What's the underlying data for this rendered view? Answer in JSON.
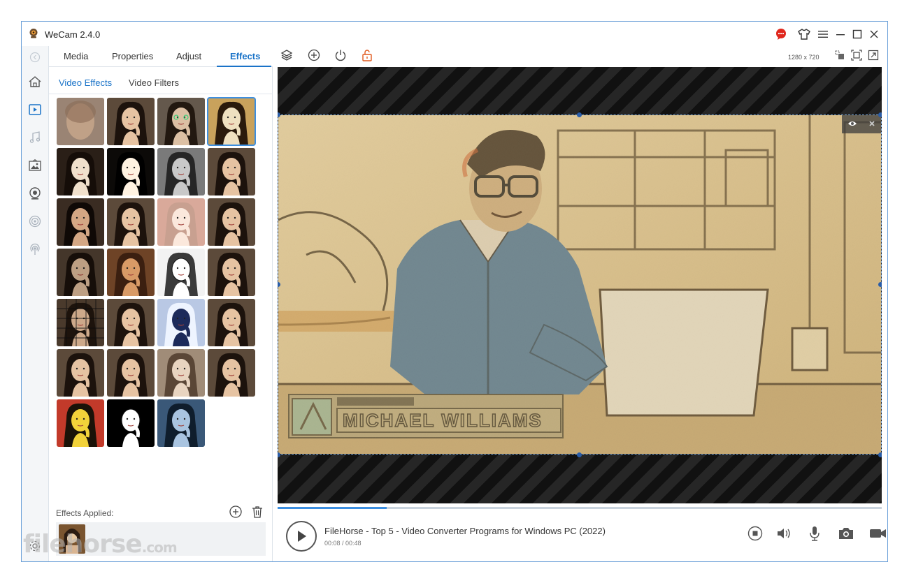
{
  "window": {
    "title": "WeCam 2.4.0",
    "resolution": "1280 x 720"
  },
  "tabs": [
    {
      "label": "Media"
    },
    {
      "label": "Properties"
    },
    {
      "label": "Adjust"
    },
    {
      "label": "Effects",
      "active": true
    }
  ],
  "effects_panel": {
    "subtabs": [
      {
        "label": "Video Effects",
        "active": true
      },
      {
        "label": "Video Filters"
      }
    ],
    "thumbnails": [
      "blur",
      "normal",
      "face-detect",
      "sketch-selected",
      "dark-vignette",
      "high-contrast",
      "grayscale",
      "normal",
      "dark",
      "normal",
      "light-leak",
      "normal",
      "noise",
      "sepia",
      "pencil-bw",
      "normal",
      "grid",
      "normal",
      "negative",
      "normal",
      "normal",
      "normal",
      "faded",
      "normal",
      "pop-art",
      "silhouette",
      "cool-tone"
    ],
    "applied_label": "Effects Applied:"
  },
  "video": {
    "caption": "MICHAEL WILLIAMS"
  },
  "player": {
    "title": "FileHorse - Top 5 - Video Converter Programs for Windows PC (2022)",
    "time": "00:08 / 00:48",
    "progress": 0.18
  },
  "watermark": {
    "text": "filehorse",
    "suffix": ".com"
  },
  "colors": {
    "accent": "#1a73c8",
    "selection": "#3d8fe0"
  },
  "icons": {
    "titlebar": [
      "chat-icon",
      "skin-icon",
      "menu-icon",
      "minimize-icon",
      "maximize-icon",
      "close-icon"
    ],
    "toolbar": [
      "layers-icon",
      "add-icon",
      "power-icon",
      "unlock-icon"
    ],
    "strip": [
      "back-icon",
      "home-icon",
      "video-icon",
      "music-icon",
      "image-icon",
      "webcam-icon",
      "screen-capture-icon",
      "broadcast-icon",
      "settings-icon"
    ]
  }
}
